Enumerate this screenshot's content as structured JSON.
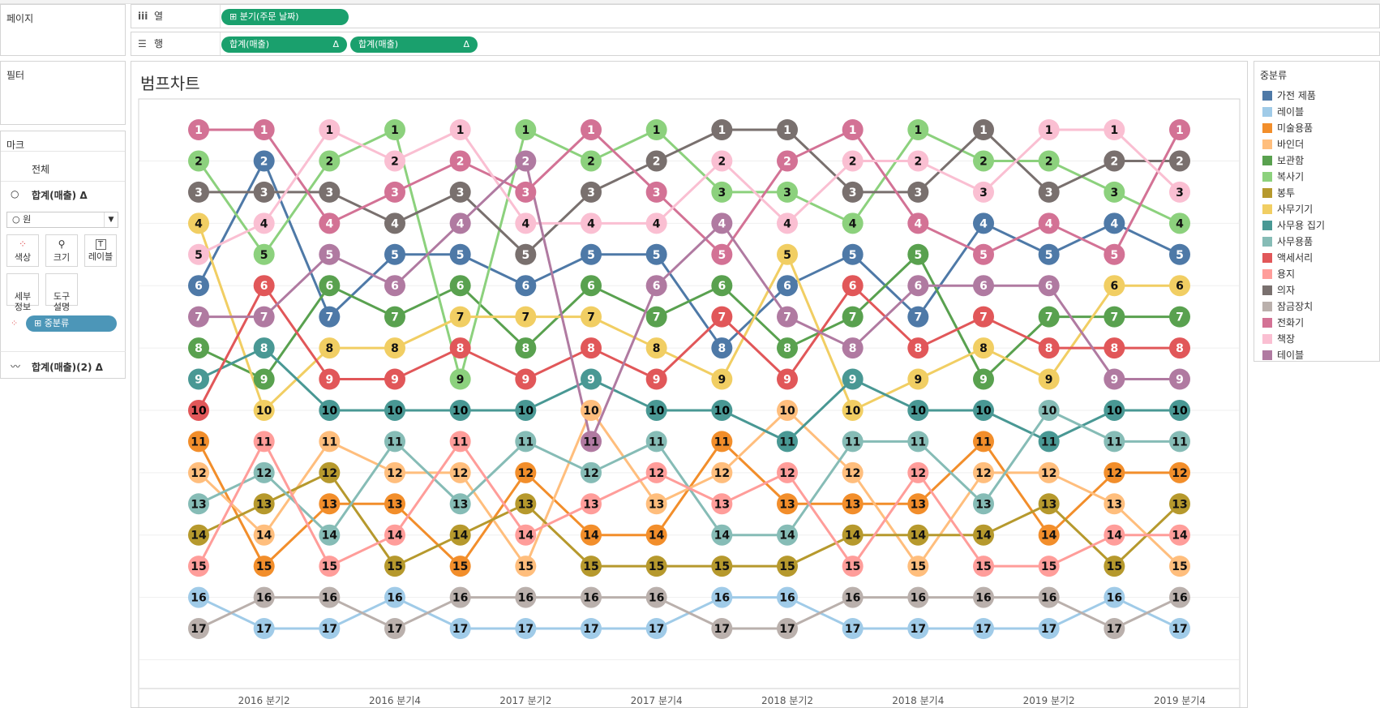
{
  "shelves": {
    "pages_title": "페이지",
    "columns_label": "열",
    "rows_label": "행",
    "columns_pill": "분기(주문 날짜)",
    "rows_pills": [
      "합계(매출)",
      "합계(매출)"
    ],
    "delta": "Δ"
  },
  "filters": {
    "title": "필터"
  },
  "marks": {
    "title": "마크",
    "all_label": "전체",
    "measure_label": "합계(매출)",
    "mark_type": "원",
    "buttons": [
      "색상",
      "크기",
      "레이블",
      "세부\n정보",
      "도구\n설명"
    ],
    "color_field": "중분류",
    "measure2_label": "합계(매출)(2)"
  },
  "view": {
    "title": "범프차트"
  },
  "legend": {
    "title": "중분류",
    "items": [
      {
        "label": "가전 제품",
        "color": "#4e79a7"
      },
      {
        "label": "레이블",
        "color": "#a0cbe8"
      },
      {
        "label": "미술용품",
        "color": "#f28e2b"
      },
      {
        "label": "바인더",
        "color": "#ffbe7d"
      },
      {
        "label": "보관함",
        "color": "#59a14f"
      },
      {
        "label": "복사기",
        "color": "#8cd17d"
      },
      {
        "label": "봉투",
        "color": "#b6992d"
      },
      {
        "label": "사무기기",
        "color": "#f1ce63"
      },
      {
        "label": "사무용 집기",
        "color": "#499894"
      },
      {
        "label": "사무용품",
        "color": "#86bcb6"
      },
      {
        "label": "액세서리",
        "color": "#e15759"
      },
      {
        "label": "용지",
        "color": "#ff9d9a"
      },
      {
        "label": "의자",
        "color": "#79706e"
      },
      {
        "label": "잠금장치",
        "color": "#bab0ac"
      },
      {
        "label": "전화기",
        "color": "#d37295"
      },
      {
        "label": "책장",
        "color": "#fabfd2"
      },
      {
        "label": "테이블",
        "color": "#b07aa1"
      }
    ]
  },
  "chart_data": {
    "type": "line",
    "x_ticks_shown": [
      "2016 분기2",
      "2016 분기4",
      "2017 분기2",
      "2017 분기4",
      "2018 분기2",
      "2018 분기4",
      "2019 분기2",
      "2019 분기4"
    ],
    "x": [
      "2016 분기1",
      "2016 분기2",
      "2016 분기3",
      "2016 분기4",
      "2017 분기1",
      "2017 분기2",
      "2017 분기3",
      "2017 분기4",
      "2018 분기1",
      "2018 분기2",
      "2018 분기3",
      "2018 분기4",
      "2019 분기1",
      "2019 분기2",
      "2019 분기3",
      "2019 분기4"
    ],
    "y_reversed": true,
    "ylim": [
      1,
      17
    ],
    "series": [
      {
        "name": "가전 제품",
        "ranks": [
          6,
          2,
          7,
          5,
          5,
          6,
          5,
          5,
          8,
          6,
          5,
          7,
          4,
          5,
          4,
          5
        ]
      },
      {
        "name": "레이블",
        "ranks": [
          16,
          17,
          17,
          16,
          17,
          17,
          17,
          17,
          16,
          16,
          17,
          17,
          17,
          17,
          16,
          17
        ]
      },
      {
        "name": "미술용품",
        "ranks": [
          11,
          15,
          13,
          13,
          15,
          12,
          14,
          14,
          11,
          13,
          13,
          13,
          11,
          14,
          12,
          12
        ]
      },
      {
        "name": "바인더",
        "ranks": [
          12,
          14,
          11,
          12,
          12,
          15,
          10,
          13,
          12,
          10,
          12,
          15,
          12,
          12,
          13,
          15
        ]
      },
      {
        "name": "보관함",
        "ranks": [
          8,
          9,
          6,
          7,
          6,
          8,
          6,
          7,
          6,
          8,
          7,
          5,
          9,
          7,
          7,
          7
        ]
      },
      {
        "name": "복사기",
        "ranks": [
          2,
          5,
          2,
          1,
          9,
          1,
          2,
          1,
          3,
          3,
          4,
          1,
          2,
          2,
          3,
          4
        ]
      },
      {
        "name": "봉투",
        "ranks": [
          14,
          13,
          12,
          15,
          14,
          13,
          15,
          15,
          15,
          15,
          14,
          14,
          14,
          13,
          15,
          13
        ]
      },
      {
        "name": "사무기기",
        "ranks": [
          4,
          10,
          8,
          8,
          7,
          7,
          7,
          8,
          9,
          5,
          10,
          9,
          8,
          9,
          6,
          6
        ]
      },
      {
        "name": "사무용 집기",
        "ranks": [
          9,
          8,
          10,
          10,
          10,
          10,
          9,
          10,
          10,
          11,
          9,
          10,
          10,
          11,
          10,
          10
        ]
      },
      {
        "name": "사무용품",
        "ranks": [
          13,
          12,
          14,
          11,
          13,
          11,
          12,
          11,
          14,
          14,
          11,
          11,
          13,
          10,
          11,
          11
        ]
      },
      {
        "name": "액세서리",
        "ranks": [
          10,
          6,
          9,
          9,
          8,
          9,
          8,
          9,
          7,
          9,
          6,
          8,
          7,
          8,
          8,
          8
        ]
      },
      {
        "name": "용지",
        "ranks": [
          15,
          11,
          15,
          14,
          11,
          14,
          13,
          12,
          13,
          12,
          15,
          12,
          15,
          15,
          14,
          14
        ]
      },
      {
        "name": "의자",
        "ranks": [
          3,
          3,
          3,
          4,
          3,
          5,
          3,
          2,
          1,
          1,
          3,
          3,
          1,
          3,
          2,
          2
        ]
      },
      {
        "name": "잠금장치",
        "ranks": [
          17,
          16,
          16,
          17,
          16,
          16,
          16,
          16,
          17,
          17,
          16,
          16,
          16,
          16,
          17,
          16
        ]
      },
      {
        "name": "전화기",
        "ranks": [
          1,
          1,
          4,
          3,
          2,
          3,
          1,
          3,
          5,
          2,
          1,
          4,
          5,
          4,
          5,
          1
        ]
      },
      {
        "name": "책장",
        "ranks": [
          5,
          4,
          1,
          2,
          1,
          4,
          4,
          4,
          2,
          4,
          2,
          2,
          3,
          1,
          1,
          3
        ]
      },
      {
        "name": "테이블",
        "ranks": [
          7,
          7,
          5,
          6,
          4,
          2,
          11,
          6,
          4,
          7,
          8,
          6,
          6,
          6,
          9,
          9
        ]
      }
    ]
  }
}
